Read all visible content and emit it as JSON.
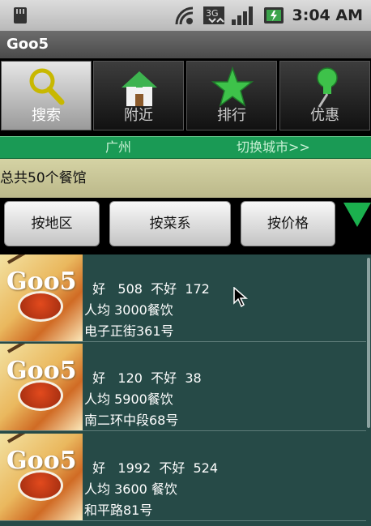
{
  "status_bar": {
    "time": "3:04 AM"
  },
  "app": {
    "title": "Goo5"
  },
  "tabs": [
    {
      "label": "搜索",
      "icon": "search-icon",
      "active": true
    },
    {
      "label": "附近",
      "icon": "home-icon",
      "active": false
    },
    {
      "label": "排行",
      "icon": "star-icon",
      "active": false
    },
    {
      "label": "优惠",
      "icon": "pin-icon",
      "active": false
    }
  ],
  "city_bar": {
    "city": "广州",
    "switch_label": "切换城市>>"
  },
  "count_text": "总共50个餐馆",
  "filters": {
    "by_area": "按地区",
    "by_cuisine": "按菜系",
    "by_price": "按价格"
  },
  "restaurants": [
    {
      "line1": "  好   508  不好  172",
      "line2": "人均 3000餐饮",
      "line3": "电子正街361号"
    },
    {
      "line1": "  好   120  不好  38",
      "line2": "人均 5900餐饮",
      "line3": "南二环中段68号"
    },
    {
      "line1": "  好   1992  不好  524",
      "line2": "人均  3600 餐饮",
      "line3": "和平路81号"
    }
  ],
  "thumb_logo": "Goo5",
  "colors": {
    "accent_green": "#1a9a55",
    "list_bg": "#264a47",
    "count_bar": "#c9c696"
  }
}
